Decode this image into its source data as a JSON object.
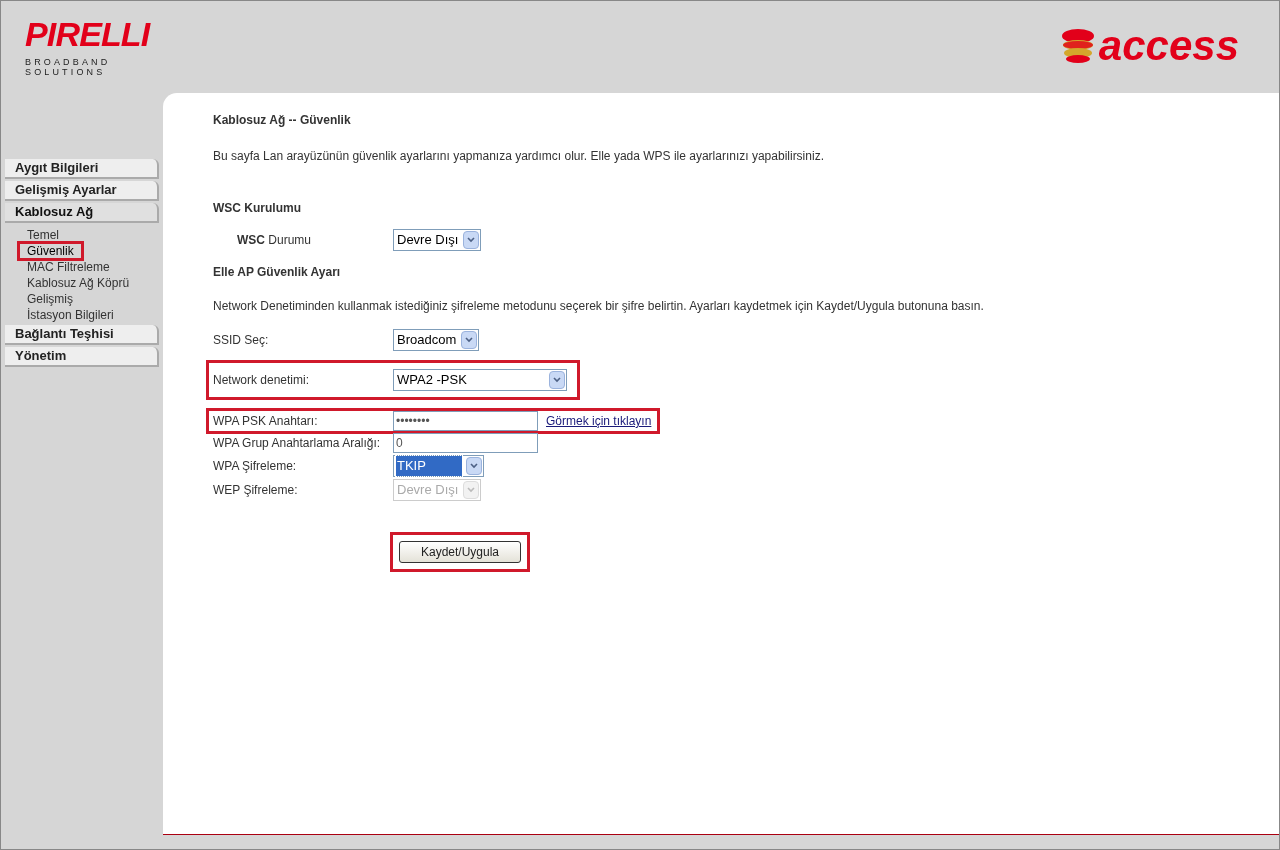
{
  "header": {
    "brand": "PIRELLI",
    "brand_sub_1": "BROADBAND",
    "brand_sub_2": "SOLUTIONS",
    "partner": "access"
  },
  "sidebar": {
    "items": [
      {
        "label": "Aygıt Bilgileri",
        "selected": false
      },
      {
        "label": "Gelişmiş Ayarlar",
        "selected": false
      },
      {
        "label": "Kablosuz Ağ",
        "selected": true,
        "children": [
          {
            "label": "Temel",
            "selected": false,
            "highlighted": false
          },
          {
            "label": "Güvenlik",
            "selected": true,
            "highlighted": true
          },
          {
            "label": "MAC Filtreleme",
            "selected": false,
            "highlighted": false
          },
          {
            "label": "Kablosuz Ağ Köprü",
            "selected": false,
            "highlighted": false
          },
          {
            "label": "Gelişmiş",
            "selected": false,
            "highlighted": false
          },
          {
            "label": "İstasyon Bilgileri",
            "selected": false,
            "highlighted": false
          }
        ]
      },
      {
        "label": "Bağlantı Teşhisi",
        "selected": false
      },
      {
        "label": "Yönetim",
        "selected": false
      }
    ]
  },
  "page": {
    "title": "Kablosuz Ağ -- Güvenlik",
    "intro": "Bu sayfa Lan arayüzünün güvenlik ayarlarını yapmanıza yardımcı olur. Elle yada WPS ile ayarlarınızı yapabilirsiniz.",
    "wsc_heading": "WSC Kurulumu",
    "wsc_label": "**WSC** Durumu",
    "wsc_value": "Devre Dışı",
    "manual_heading": "Elle AP Güvenlik Ayarı",
    "manual_intro": "Network Denetiminden kullanmak istediğiniz şifreleme metodunu seçerek bir şifre belirtin. Ayarları kaydetmek için Kaydet/Uygula butonuna basın.",
    "ssid": {
      "label": "SSID Seç:",
      "value": "Broadcom"
    },
    "fields": [
      {
        "kind": "select",
        "label": "Network denetimi:",
        "value": "WPA2 -PSK",
        "highlighted": true,
        "disabled": false,
        "focused": false,
        "wide": true
      },
      {
        "kind": "password",
        "label": "WPA PSK Anahtarı:",
        "value": "••••••••",
        "link": "Görmek için tıklayın",
        "highlighted": true
      },
      {
        "kind": "text",
        "label": "WPA Grup Anahtarlama Aralığı:",
        "value": "0",
        "highlighted": false
      },
      {
        "kind": "select",
        "label": "WPA Şifreleme:",
        "value": "TKIP",
        "highlighted": false,
        "disabled": false,
        "focused": true,
        "wide": false
      },
      {
        "kind": "select",
        "label": "WEP Şifreleme:",
        "value": "Devre Dışı",
        "highlighted": false,
        "disabled": true,
        "focused": false,
        "wide": false
      }
    ],
    "save": {
      "label": "Kaydet/Uygula",
      "highlighted": true
    }
  }
}
